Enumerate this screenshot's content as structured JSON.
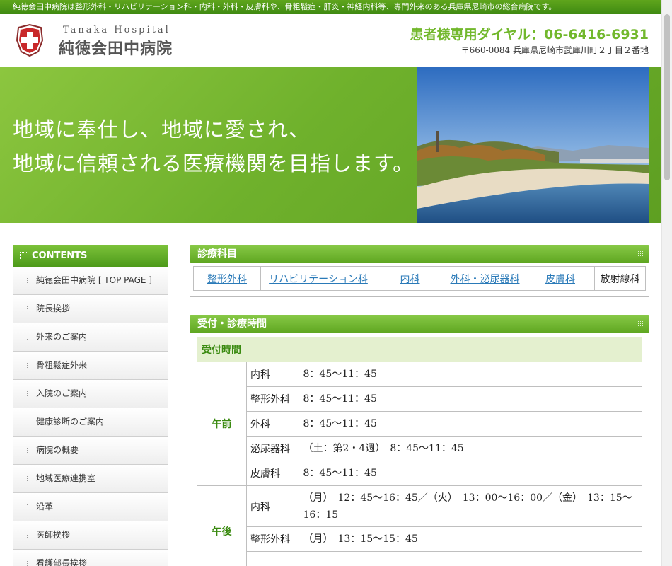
{
  "top_strip": "純徳会田中病院は整形外科・リハビリテーション科・内科・外科・皮膚科や、骨粗鬆症・肝炎・神経内科等、専門外来のある兵庫県尼崎市の総合病院です。",
  "header": {
    "logo_en": "Tanaka Hospital",
    "logo_jp": "純徳会田中病院",
    "phone": "患者様専用ダイヤル：06-6416-6931",
    "address": "〒660-0084  兵庫県尼崎市武庫川町２丁目２番地"
  },
  "hero": {
    "line1": "地域に奉仕し、地域に愛され、",
    "line2": "地域に信頼される医療機関を目指します。"
  },
  "sidebar": {
    "title": "CONTENTS",
    "items": [
      "純徳会田中病院 [ TOP PAGE ]",
      "院長挨拶",
      "外来のご案内",
      "骨粗鬆症外来",
      "入院のご案内",
      "健康診断のご案内",
      "病院の概要",
      "地域医療連携室",
      "沿革",
      "医師挨拶",
      "看護部長挨拶"
    ]
  },
  "departments": {
    "title": "診療科目",
    "items": [
      "整形外科",
      "リハビリテーション科",
      "内科",
      "外科・泌尿器科",
      "皮膚科",
      "放射線科"
    ]
  },
  "hours": {
    "title": "受付・診療時間",
    "caption": "受付時間",
    "morning_label": "午前",
    "afternoon_label": "午後",
    "morning": [
      {
        "dept": "内科",
        "time": "8：45〜11：45"
      },
      {
        "dept": "整形外科",
        "time": "8：45〜11：45"
      },
      {
        "dept": "外科",
        "time": "8：45〜11：45"
      },
      {
        "dept": "泌尿器科",
        "time": "（土：第2・4週）　8：45〜11：45"
      },
      {
        "dept": "皮膚科",
        "time": "8：45〜11：45"
      }
    ],
    "afternoon": [
      {
        "dept": "内科",
        "time": "（月）　12：45〜16：45／（火）　13：00〜16：00／（金）　13：15〜16：15"
      },
      {
        "dept": "整形外科",
        "time": "（月）　13：15〜15：45"
      }
    ]
  },
  "colors": {
    "brand_green": "#5ea620",
    "link_blue": "#2a7ab8",
    "phone_green": "#72b82d"
  }
}
